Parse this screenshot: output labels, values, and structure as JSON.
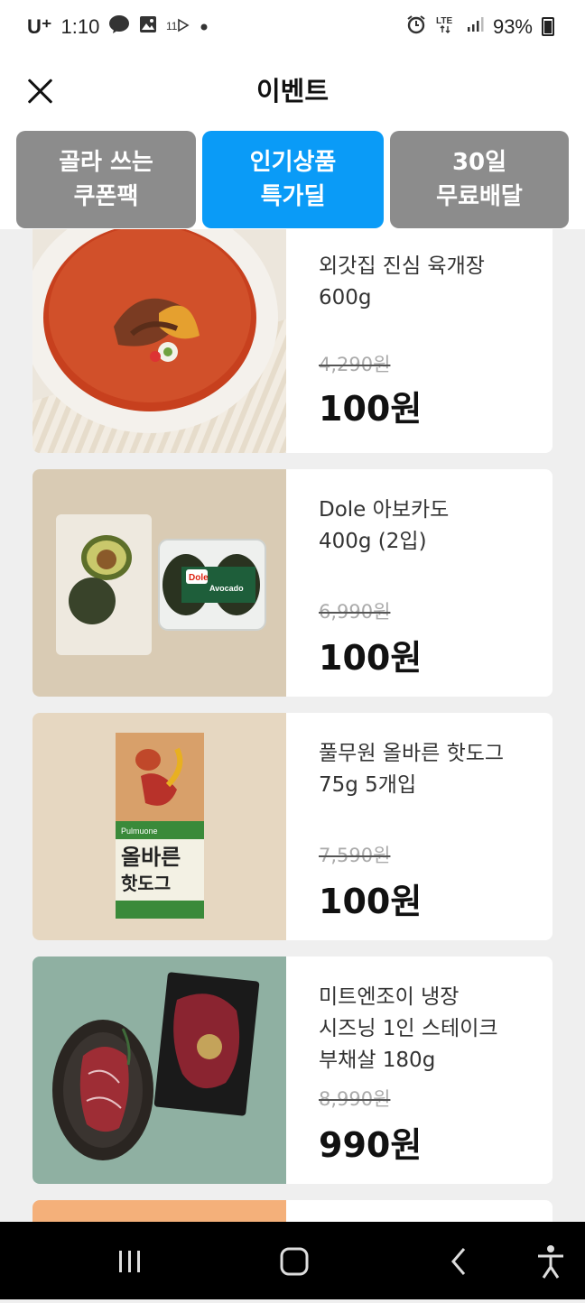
{
  "status": {
    "carrier": "U⁺",
    "time": "1:10",
    "notif_icons": [
      "talk-icon",
      "gallery-icon",
      "11st-icon"
    ],
    "battery": "93%"
  },
  "appbar": {
    "title": "이벤트"
  },
  "tabs": [
    {
      "line1": "골라 쓰는",
      "line2": "쿠폰팩",
      "active": false
    },
    {
      "line1": "인기상품",
      "line2": "특가딜",
      "active": true
    },
    {
      "line1": "30일",
      "line2": "무료배달",
      "active": false
    }
  ],
  "products": [
    {
      "name": "외갓집 진심 육개장\n600g",
      "original_price": "4,290원",
      "price": "100원"
    },
    {
      "name": "Dole 아보카도\n400g (2입)",
      "original_price": "6,990원",
      "price": "100원"
    },
    {
      "name": "풀무원 올바른 핫도그\n75g 5개입",
      "original_price": "7,590원",
      "price": "100원"
    },
    {
      "name": "미트엔조이 냉장\n시즈닝 1인 스테이크\n부채살 180g",
      "original_price": "8,990원",
      "price": "990원"
    }
  ],
  "image_text": {
    "avocado_brand": "Dole",
    "avocado_label": "Avocado",
    "hotdog_brand": "Pulmuone",
    "hotdog_title_1": "올바른",
    "hotdog_title_2": "핫도그"
  },
  "colors": {
    "accent": "#0a9bf7",
    "tab_inactive": "#8c8c8c"
  }
}
